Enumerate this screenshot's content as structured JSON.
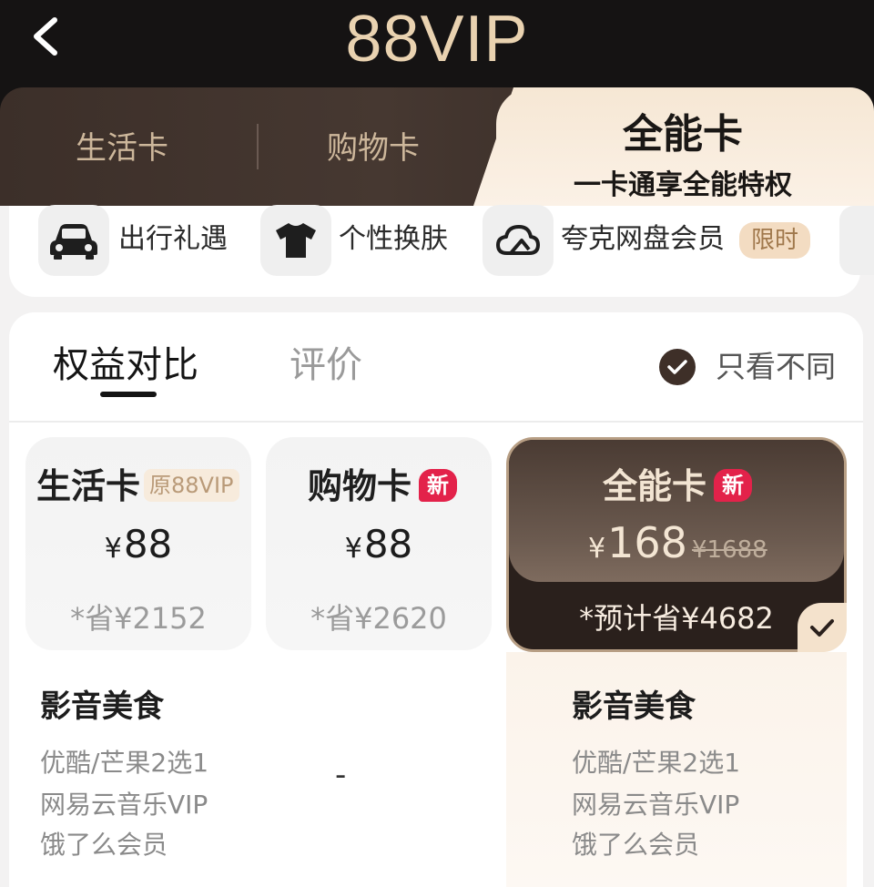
{
  "header": {
    "title": "88VIP",
    "back_label": "<"
  },
  "card_tabs": [
    {
      "label": "生活卡"
    },
    {
      "label": "购物卡"
    },
    {
      "label": "全能卡",
      "subtitle": "一卡通享全能特权",
      "active": true
    }
  ],
  "benefits": [
    {
      "label": "出行礼遇",
      "icon": "car-icon"
    },
    {
      "label": "个性换肤",
      "icon": "tshirt-icon"
    },
    {
      "label": "夸克网盘会员",
      "icon": "cloud-icon",
      "badge": "限时"
    }
  ],
  "compare": {
    "tabs": [
      {
        "label": "权益对比",
        "active": true
      },
      {
        "label": "评价",
        "active": false
      }
    ],
    "filter_label": "只看不同",
    "filter_checked": true
  },
  "plans": [
    {
      "name": "生活卡",
      "badge": "原88VIP",
      "currency": "¥",
      "price": "88",
      "saving": "*省¥2152"
    },
    {
      "name": "购物卡",
      "badge": "新",
      "currency": "¥",
      "price": "88",
      "saving": "*省¥2620"
    },
    {
      "name": "全能卡",
      "badge": "新",
      "currency": "¥",
      "price": "168",
      "original_price": "¥1688",
      "saving": "*预计省¥4682",
      "selected": true
    }
  ],
  "sections": [
    {
      "title": "影音美食",
      "life_items": [
        "优酷/芒果2选1",
        "网易云音乐VIP",
        "饿了么会员"
      ],
      "shopping_value": "-",
      "allround_items": [
        "优酷/芒果2选1",
        "网易云音乐VIP",
        "饿了么会员"
      ]
    }
  ],
  "colors": {
    "header_bg": "#151313",
    "header_title": "#e9d2b0",
    "dark_tab": "#463831",
    "active_tab": "#f6e7d4",
    "new_badge": "#e3224a",
    "accent_brown": "#3e2f28"
  }
}
